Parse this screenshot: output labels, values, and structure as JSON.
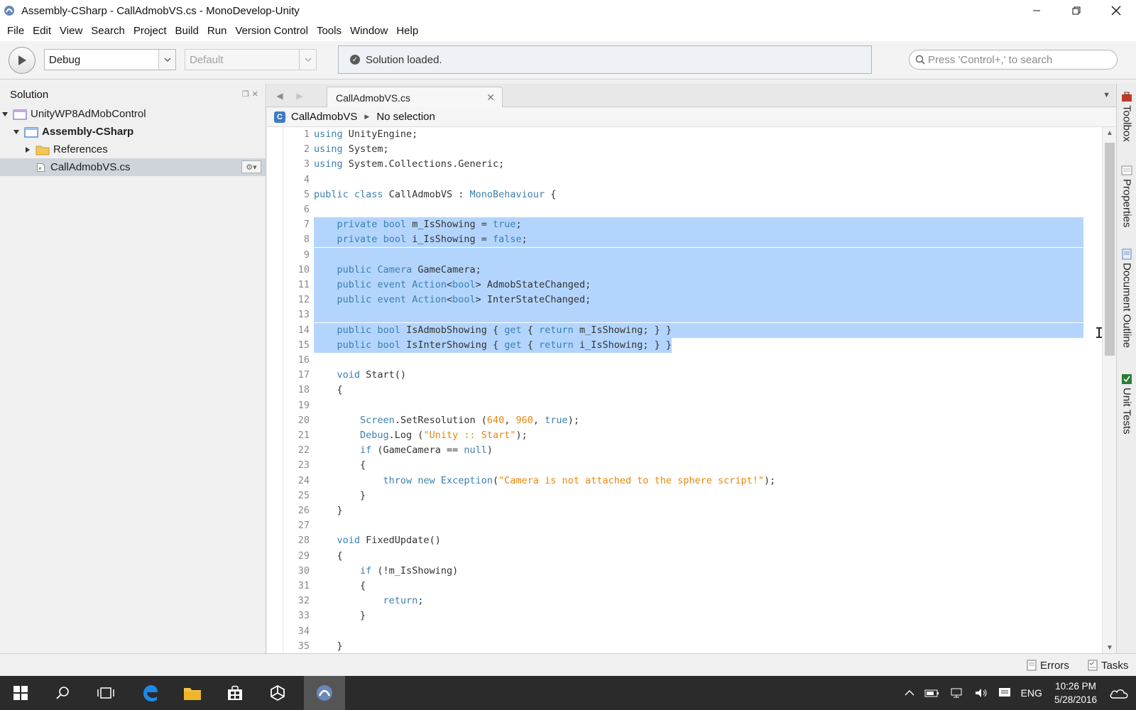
{
  "window": {
    "title": "Assembly-CSharp - CallAdmobVS.cs - MonoDevelop-Unity"
  },
  "menu": [
    "File",
    "Edit",
    "View",
    "Search",
    "Project",
    "Build",
    "Run",
    "Version Control",
    "Tools",
    "Window",
    "Help"
  ],
  "toolbar": {
    "config": "Debug",
    "target": "Default",
    "status": "Solution loaded.",
    "search_placeholder": "Press 'Control+,' to search"
  },
  "solution": {
    "title": "Solution",
    "items": [
      {
        "label": "UnityWP8AdMobControl"
      },
      {
        "label": "Assembly-CSharp"
      },
      {
        "label": "References"
      },
      {
        "label": "CallAdmobVS.cs"
      }
    ]
  },
  "editor": {
    "tab": "CallAdmobVS.cs",
    "path_class": "CallAdmobVS",
    "path_member": "No selection",
    "class_badge": "C"
  },
  "code_lines": [
    {
      "n": "1"
    },
    {
      "n": "2"
    },
    {
      "n": "3"
    },
    {
      "n": "4"
    },
    {
      "n": "5"
    },
    {
      "n": "6"
    },
    {
      "n": "7"
    },
    {
      "n": "8"
    },
    {
      "n": "9"
    },
    {
      "n": "10"
    },
    {
      "n": "11"
    },
    {
      "n": "12"
    },
    {
      "n": "13"
    },
    {
      "n": "14"
    },
    {
      "n": "15"
    },
    {
      "n": "16"
    },
    {
      "n": "17"
    },
    {
      "n": "18"
    },
    {
      "n": "19"
    },
    {
      "n": "20"
    },
    {
      "n": "21"
    },
    {
      "n": "22"
    },
    {
      "n": "23"
    },
    {
      "n": "24"
    },
    {
      "n": "25"
    },
    {
      "n": "26"
    },
    {
      "n": "27"
    },
    {
      "n": "28"
    },
    {
      "n": "29"
    },
    {
      "n": "30"
    },
    {
      "n": "31"
    },
    {
      "n": "32"
    },
    {
      "n": "33"
    },
    {
      "n": "34"
    },
    {
      "n": "35"
    }
  ],
  "code": {
    "l1": [
      "using",
      " UnityEngine;"
    ],
    "l2": [
      "using",
      " System;"
    ],
    "l3": [
      "using",
      " System.Collections.Generic;"
    ],
    "l5": [
      "public",
      " ",
      "class",
      " CallAdmobVS : ",
      "MonoBehaviour",
      " {"
    ],
    "l7": [
      "    ",
      "private",
      " ",
      "bool",
      " m_IsShowing = ",
      "true",
      ";"
    ],
    "l8": [
      "    ",
      "private",
      " ",
      "bool",
      " i_IsShowing = ",
      "false",
      ";"
    ],
    "l10": [
      "    ",
      "public",
      " ",
      "Camera",
      " GameCamera;"
    ],
    "l11": [
      "    ",
      "public",
      " ",
      "event",
      " ",
      "Action",
      "<",
      "bool",
      "> AdmobStateChanged;"
    ],
    "l12": [
      "    ",
      "public",
      " ",
      "event",
      " ",
      "Action",
      "<",
      "bool",
      "> InterStateChanged;"
    ],
    "l14": [
      "    ",
      "public",
      " ",
      "bool",
      " IsAdmobShowing { ",
      "get",
      " { ",
      "return",
      " m_IsShowing; } }"
    ],
    "l15": [
      "    ",
      "public",
      " ",
      "bool",
      " IsInterShowing { ",
      "get",
      " { ",
      "return",
      " i_IsShowing; } }"
    ],
    "l17": [
      "    ",
      "void",
      " Start()"
    ],
    "l18": [
      "    {"
    ],
    "l20": [
      "        ",
      "Screen",
      ".SetResolution (",
      "640",
      ", ",
      "960",
      ", ",
      "true",
      ");"
    ],
    "l21": [
      "        ",
      "Debug",
      ".Log (",
      "\"Unity :: Start\"",
      ");"
    ],
    "l22": [
      "        ",
      "if",
      " (GameCamera == ",
      "null",
      ")"
    ],
    "l23": [
      "        {"
    ],
    "l24": [
      "            ",
      "throw",
      " ",
      "new",
      " ",
      "Exception",
      "(",
      "\"Camera is not attached to the sphere script!\"",
      ");"
    ],
    "l25": [
      "        }"
    ],
    "l26": [
      "    }"
    ],
    "l28": [
      "    ",
      "void",
      " FixedUpdate()"
    ],
    "l29": [
      "    {"
    ],
    "l30": [
      "        ",
      "if",
      " (!m_IsShowing)"
    ],
    "l31": [
      "        {"
    ],
    "l32": [
      "            ",
      "return",
      ";"
    ],
    "l33": [
      "        }"
    ],
    "l35": [
      "    }"
    ]
  },
  "right_dock": [
    "Toolbox",
    "Properties",
    "Document Outline",
    "Unit Tests"
  ],
  "statusbar": {
    "errors": "Errors",
    "tasks": "Tasks"
  },
  "taskbar": {
    "language": "ENG",
    "time": "10:26 PM",
    "date": "5/28/2016"
  },
  "colors": {
    "selection": "#b3d5fd",
    "keyword": "#3b7fb0",
    "string": "#e8870c"
  }
}
